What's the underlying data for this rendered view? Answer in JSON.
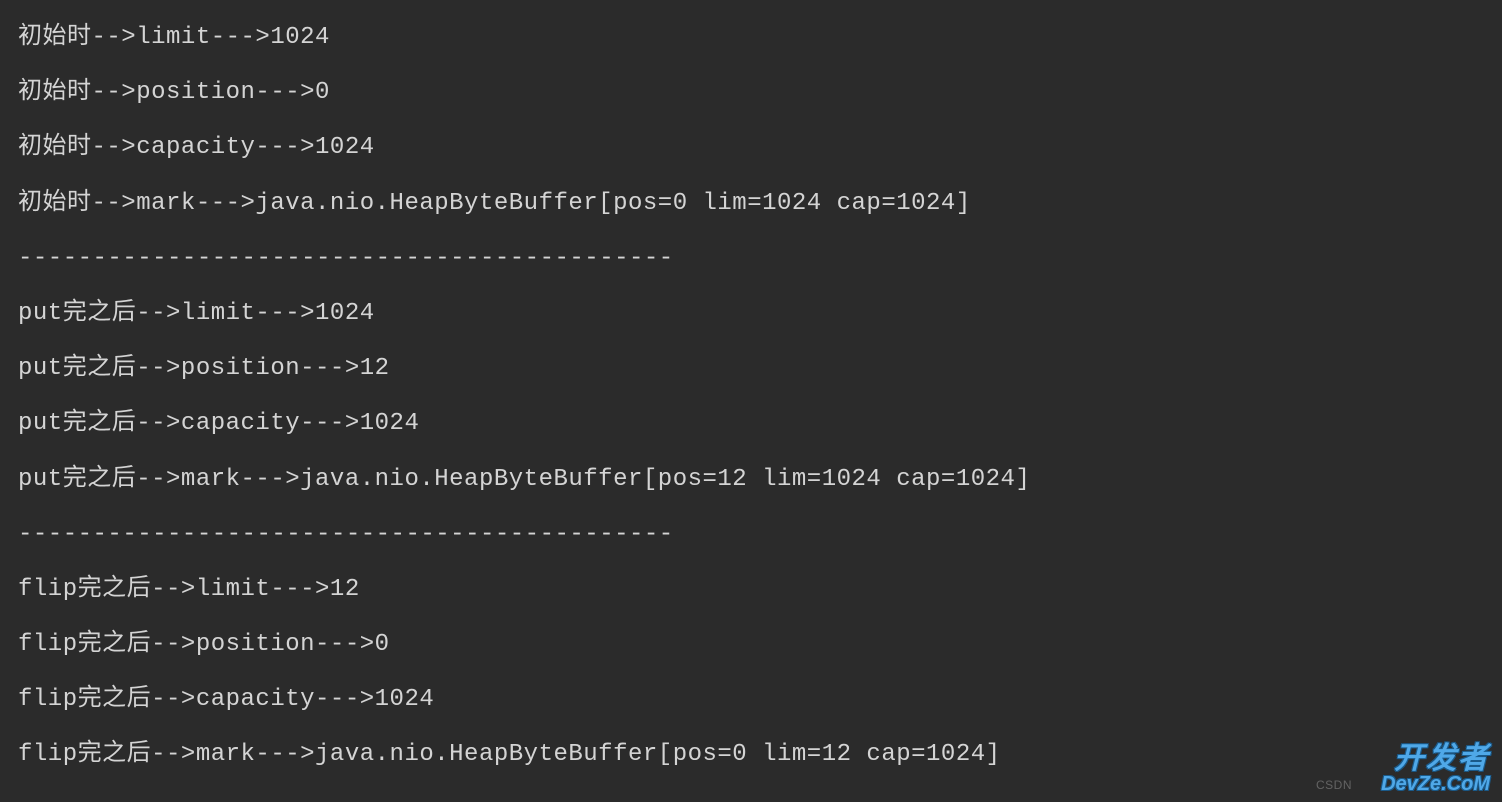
{
  "lines": {
    "l0": "初始时-->limit--->1024",
    "l1": "初始时-->position--->0",
    "l2": "初始时-->capacity--->1024",
    "l3": "初始时-->mark--->java.nio.HeapByteBuffer[pos=0 lim=1024 cap=1024]",
    "l4": "--------------------------------------------",
    "l5": "put完之后-->limit--->1024",
    "l6": "put完之后-->position--->12",
    "l7": "put完之后-->capacity--->1024",
    "l8": "put完之后-->mark--->java.nio.HeapByteBuffer[pos=12 lim=1024 cap=1024]",
    "l9": "--------------------------------------------",
    "l10": "flip完之后-->limit--->12",
    "l11": "flip完之后-->position--->0",
    "l12": "flip完之后-->capacity--->1024",
    "l13": "flip完之后-->mark--->java.nio.HeapByteBuffer[pos=0 lim=12 cap=1024]"
  },
  "watermark": {
    "logo": "开发者",
    "sublogo": "DevZe.CoM",
    "csdn": "CSDN"
  }
}
